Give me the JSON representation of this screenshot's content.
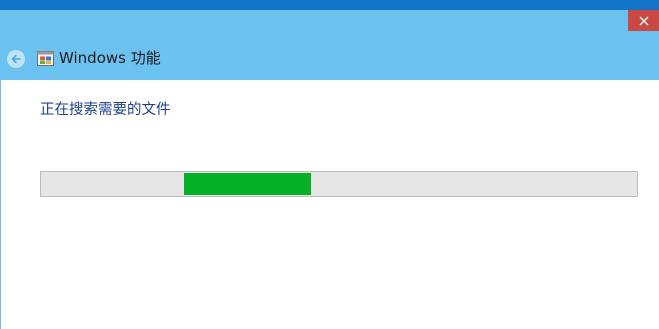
{
  "window": {
    "title": "Windows 功能",
    "icon": "windows-features-icon",
    "close_icon": "close-icon",
    "back_icon": "back-arrow-icon",
    "titlebar_color": "#6bc1f0",
    "close_color": "#c94a45"
  },
  "content": {
    "status_text": "正在搜索需要的文件",
    "status_color": "#1c3f94"
  },
  "progress": {
    "mode": "indeterminate",
    "fill_color": "#06b025",
    "track_color": "#e6e6e6"
  }
}
